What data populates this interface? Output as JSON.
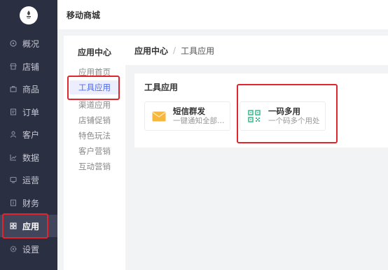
{
  "header": {
    "title": "移动商城"
  },
  "sidebar": {
    "items": [
      {
        "label": "概况",
        "icon": "overview-icon"
      },
      {
        "label": "店铺",
        "icon": "store-icon"
      },
      {
        "label": "商品",
        "icon": "goods-icon"
      },
      {
        "label": "订单",
        "icon": "order-icon"
      },
      {
        "label": "客户",
        "icon": "customer-icon"
      },
      {
        "label": "数据",
        "icon": "chart-icon"
      },
      {
        "label": "运营",
        "icon": "operation-icon"
      },
      {
        "label": "财务",
        "icon": "finance-icon"
      },
      {
        "label": "应用",
        "icon": "apps-icon"
      },
      {
        "label": "设置",
        "icon": "settings-icon"
      }
    ]
  },
  "subnav": {
    "title": "应用中心",
    "items": [
      "应用首页",
      "工具应用",
      "渠道应用",
      "店铺促销",
      "特色玩法",
      "客户营销",
      "互动营销"
    ]
  },
  "breadcrumb": {
    "root": "应用中心",
    "separator": "/",
    "current": "工具应用"
  },
  "tools_card": {
    "title": "工具应用",
    "tools": [
      {
        "name": "短信群发",
        "desc": "一键通知全部…",
        "icon": "envelope-icon"
      },
      {
        "name": "一码多用",
        "desc": "一个码多个用处",
        "icon": "qr-code-icon"
      }
    ]
  },
  "colors": {
    "sidebar_bg": "#2b2f42",
    "accent": "#4a6af0",
    "highlight_box": "#e0262c",
    "qr_green": "#3fbf93",
    "envelope": "#f6b73c"
  }
}
